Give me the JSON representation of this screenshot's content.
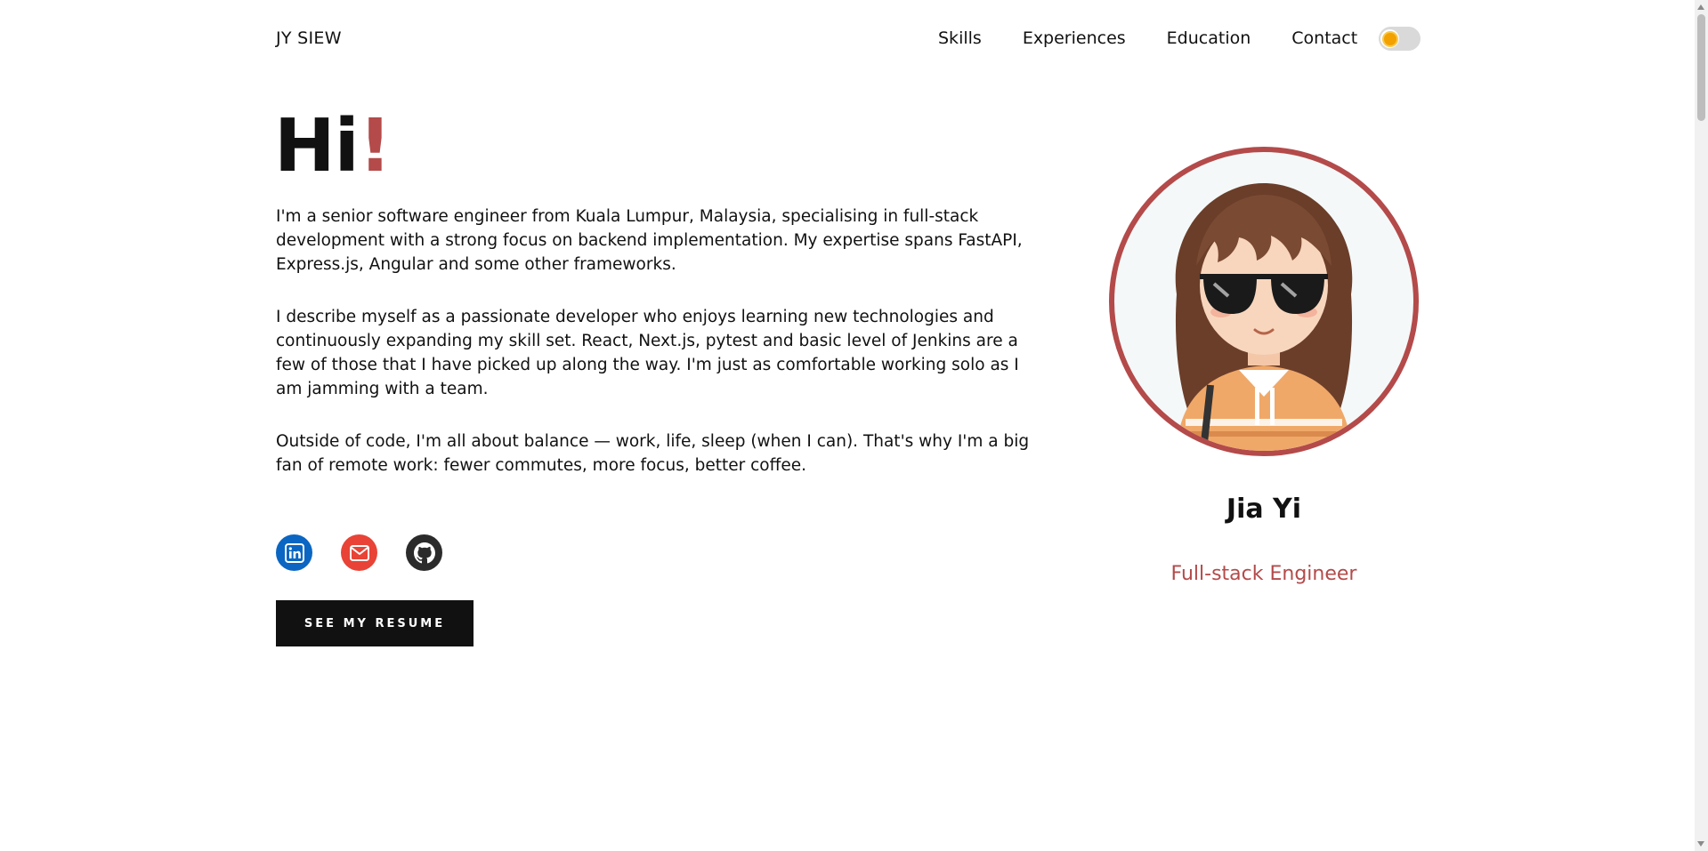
{
  "header": {
    "brand": "JY SIEW",
    "nav": [
      "Skills",
      "Experiences",
      "Education",
      "Contact"
    ],
    "theme_toggle_icon": "sun-icon"
  },
  "hero": {
    "greeting": "Hi",
    "greeting_mark": "!",
    "paragraphs": [
      "I'm a senior software engineer from Kuala Lumpur, Malaysia, specialising in full-stack development with a strong focus on backend implementation. My expertise spans FastAPI, Express.js, Angular and some other frameworks.",
      "I describe myself as a passionate developer who enjoys learning new technologies and continuously expanding my skill set. React, Next.js, pytest and basic level of Jenkins are a few of those that I have picked up along the way. I'm just as comfortable working solo as I am jamming with a team.",
      "Outside of code, I'm all about balance — work, life, sleep (when I can). That's why I'm a big fan of remote work: fewer commutes, more focus, better coffee."
    ],
    "socials": [
      {
        "icon": "linkedin-icon",
        "color": "#0a66c2"
      },
      {
        "icon": "email-icon",
        "color": "#e84336"
      },
      {
        "icon": "github-icon",
        "color": "#2b2b2b"
      }
    ],
    "resume_button": "SEE MY RESUME"
  },
  "profile": {
    "avatar_icon": "avatar-illustration",
    "name": "Jia Yi",
    "role": "Full-stack Engineer"
  },
  "colors": {
    "accent": "#b44a4a",
    "text": "#111111",
    "button_bg": "#111111"
  }
}
